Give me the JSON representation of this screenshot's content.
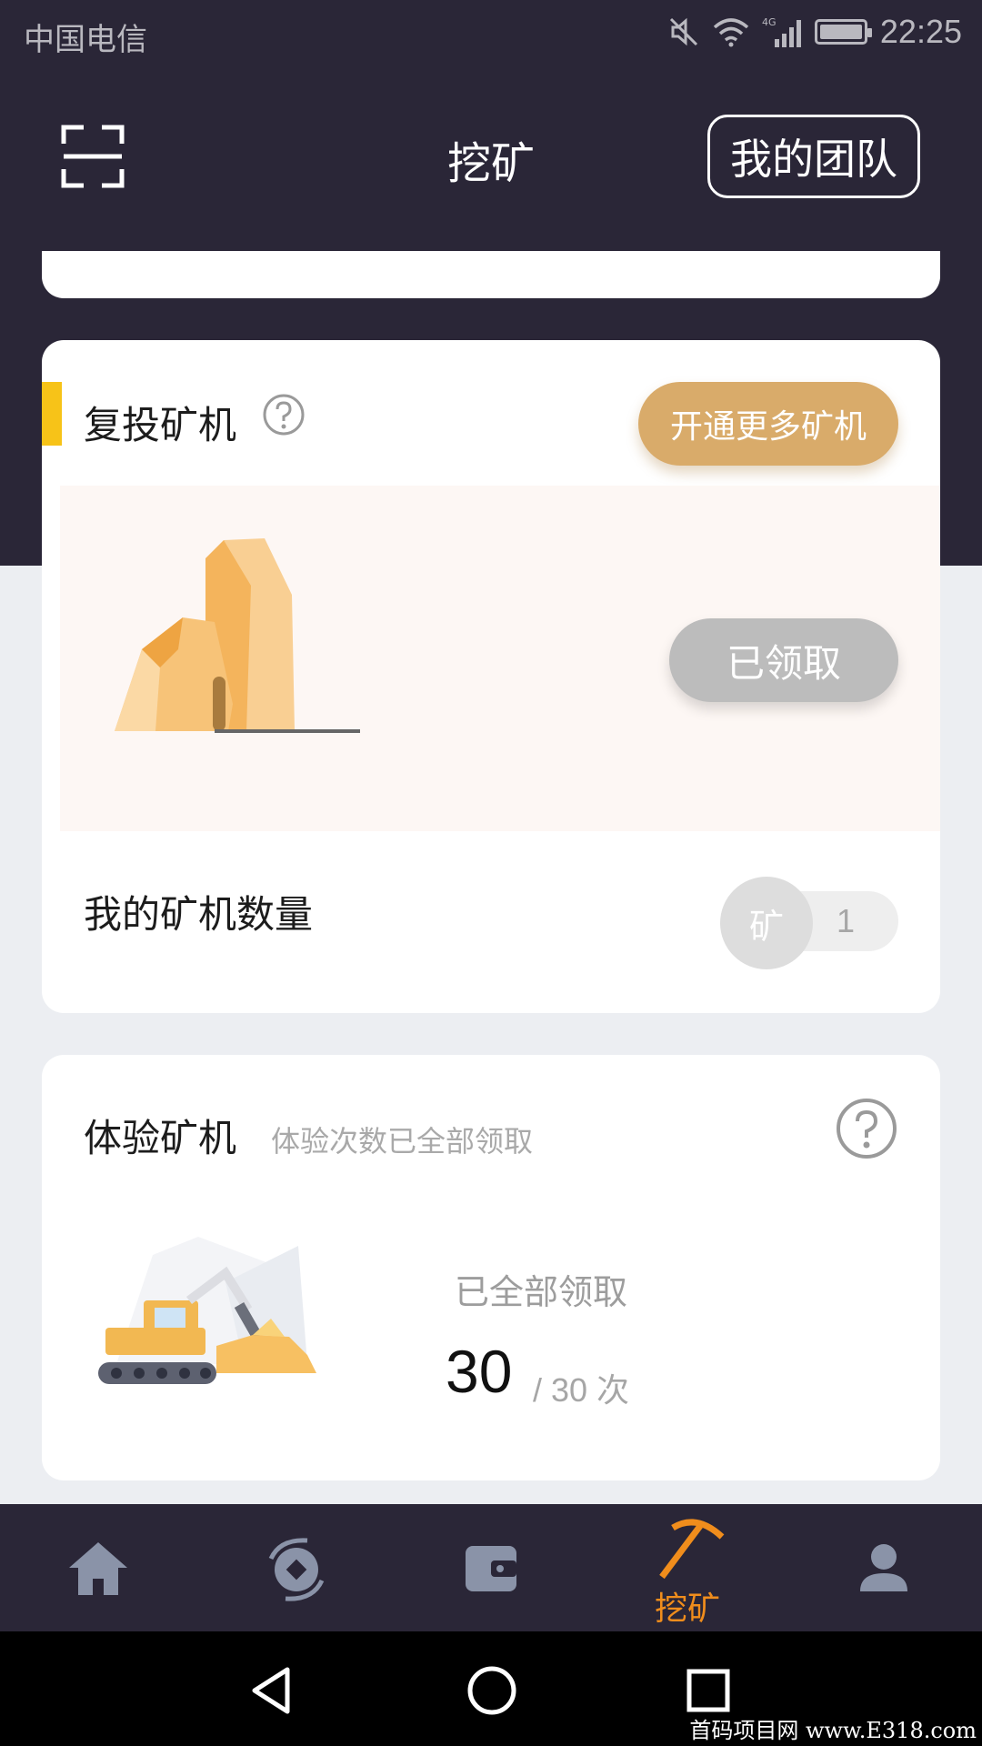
{
  "status_bar": {
    "carrier": "中国电信",
    "network": "4G",
    "time": "22:25"
  },
  "header": {
    "title": "挖矿",
    "team_button": "我的团队"
  },
  "reinvest": {
    "title": "复投矿机",
    "open_more_button": "开通更多矿机",
    "claimed_button": "已领取",
    "count_label": "我的矿机数量",
    "count_badge": "矿",
    "count_value": "1"
  },
  "trial": {
    "title": "体验矿机",
    "subtitle": "体验次数已全部领取",
    "status": "已全部领取",
    "count": "30",
    "total": "/ 30 次"
  },
  "bottom_nav": {
    "items": [
      {
        "icon": "home-icon",
        "label": ""
      },
      {
        "icon": "exchange-icon",
        "label": ""
      },
      {
        "icon": "wallet-icon",
        "label": ""
      },
      {
        "icon": "pickaxe-icon",
        "label": "挖矿",
        "active": true
      },
      {
        "icon": "person-icon",
        "label": ""
      }
    ]
  },
  "colors": {
    "header_bg": "#2a2637",
    "accent": "#f7c318",
    "gold_button": "#d9ab6a",
    "active_nav": "#f08d1c"
  },
  "watermark": "首码项目网  www.E318.com"
}
